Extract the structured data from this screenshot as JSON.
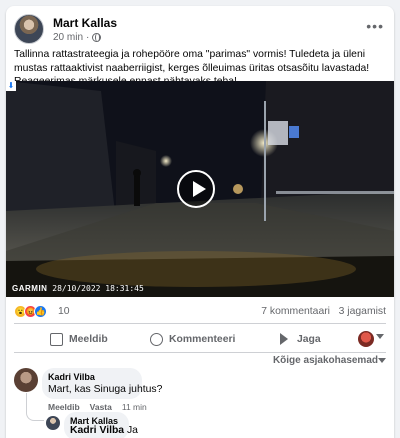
{
  "post": {
    "author": "Mart Kallas",
    "time": "20 min",
    "privacy_icon": "globe-icon",
    "text": "Tallinna rattastrateegia ja rohepööre oma \"parimas\" vormis! Tuledeta ja üleni mustas rattaaktivist naaberriigist, kerges õlleuimas üritas otsasõitu lavastada! Reageerimas märkusele ennast nähtavaks teha!",
    "video": {
      "watermark_brand": "GARMIN",
      "watermark_timestamp": "28/10/2022 18:31:45"
    },
    "reactions": {
      "icons": [
        "😮",
        "😡",
        "👍"
      ],
      "count": "10"
    },
    "comments_count": "7 kommentaari",
    "shares_count": "3 jagamist",
    "actions": {
      "like": "Meeldib",
      "comment": "Kommenteeri",
      "share": "Jaga"
    }
  },
  "comments": {
    "sort_label": "Kõige asjakohasemad",
    "items": [
      {
        "name": "Kadri Vilba",
        "text": "Mart, kas Sinuga juhtus?",
        "actions": {
          "like": "Meeldib",
          "reply": "Vasta",
          "time": "11 min"
        },
        "reply": {
          "name": "Mart Kallas",
          "tag": "Kadri Vilba",
          "text": "Ja"
        }
      }
    ]
  },
  "colors": {
    "accent": "#1877f2",
    "background": "#f0f2f5",
    "secondary_text": "#65676b"
  }
}
